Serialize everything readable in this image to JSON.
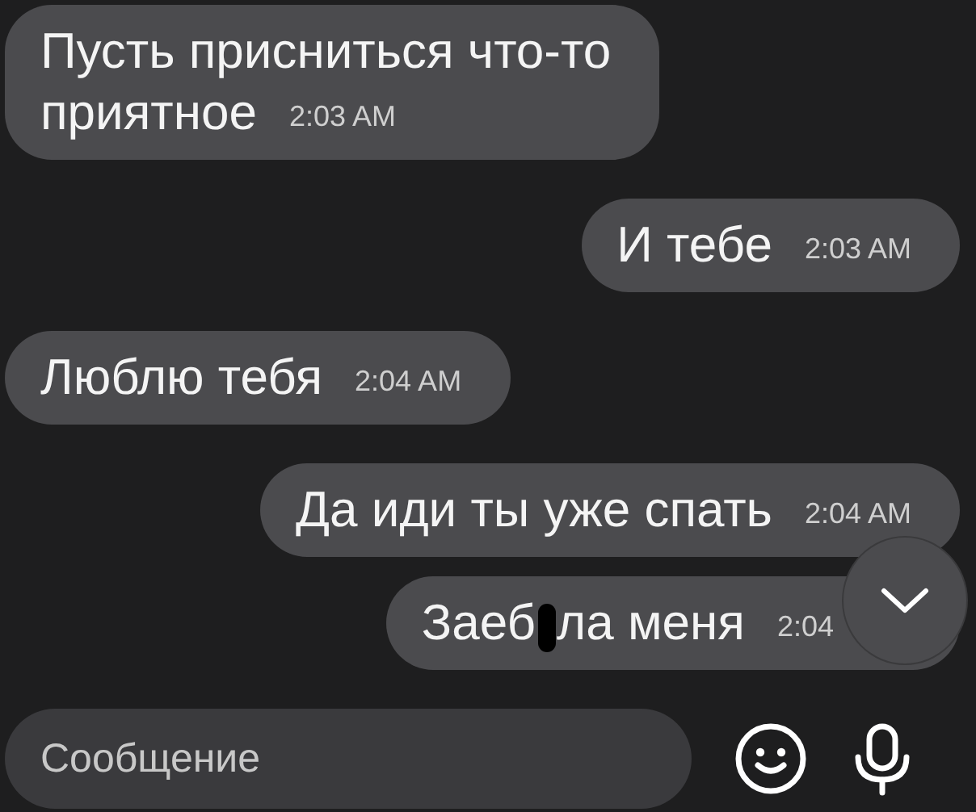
{
  "messages": [
    {
      "outgoing": false,
      "lines": [
        {
          "parts": [
            "Пусть присниться что-то"
          ]
        },
        {
          "parts": [
            "приятное"
          ]
        }
      ],
      "time": "2:03 AM"
    },
    {
      "outgoing": true,
      "lines": [
        {
          "parts": [
            "И тебе"
          ]
        }
      ],
      "time": "2:03 AM"
    },
    {
      "outgoing": false,
      "lines": [
        {
          "parts": [
            "Люблю тебя"
          ]
        }
      ],
      "time": "2:04 AM"
    },
    {
      "outgoing": true,
      "lines": [
        {
          "parts": [
            "Да иди ты уже спать"
          ]
        }
      ],
      "time": "2:04 AM"
    },
    {
      "outgoing": true,
      "lines": [
        {
          "parts": [
            "Заеб",
            "ла меня"
          ]
        }
      ],
      "time": "2:04"
    }
  ],
  "composer": {
    "placeholder": "Сообщение"
  }
}
